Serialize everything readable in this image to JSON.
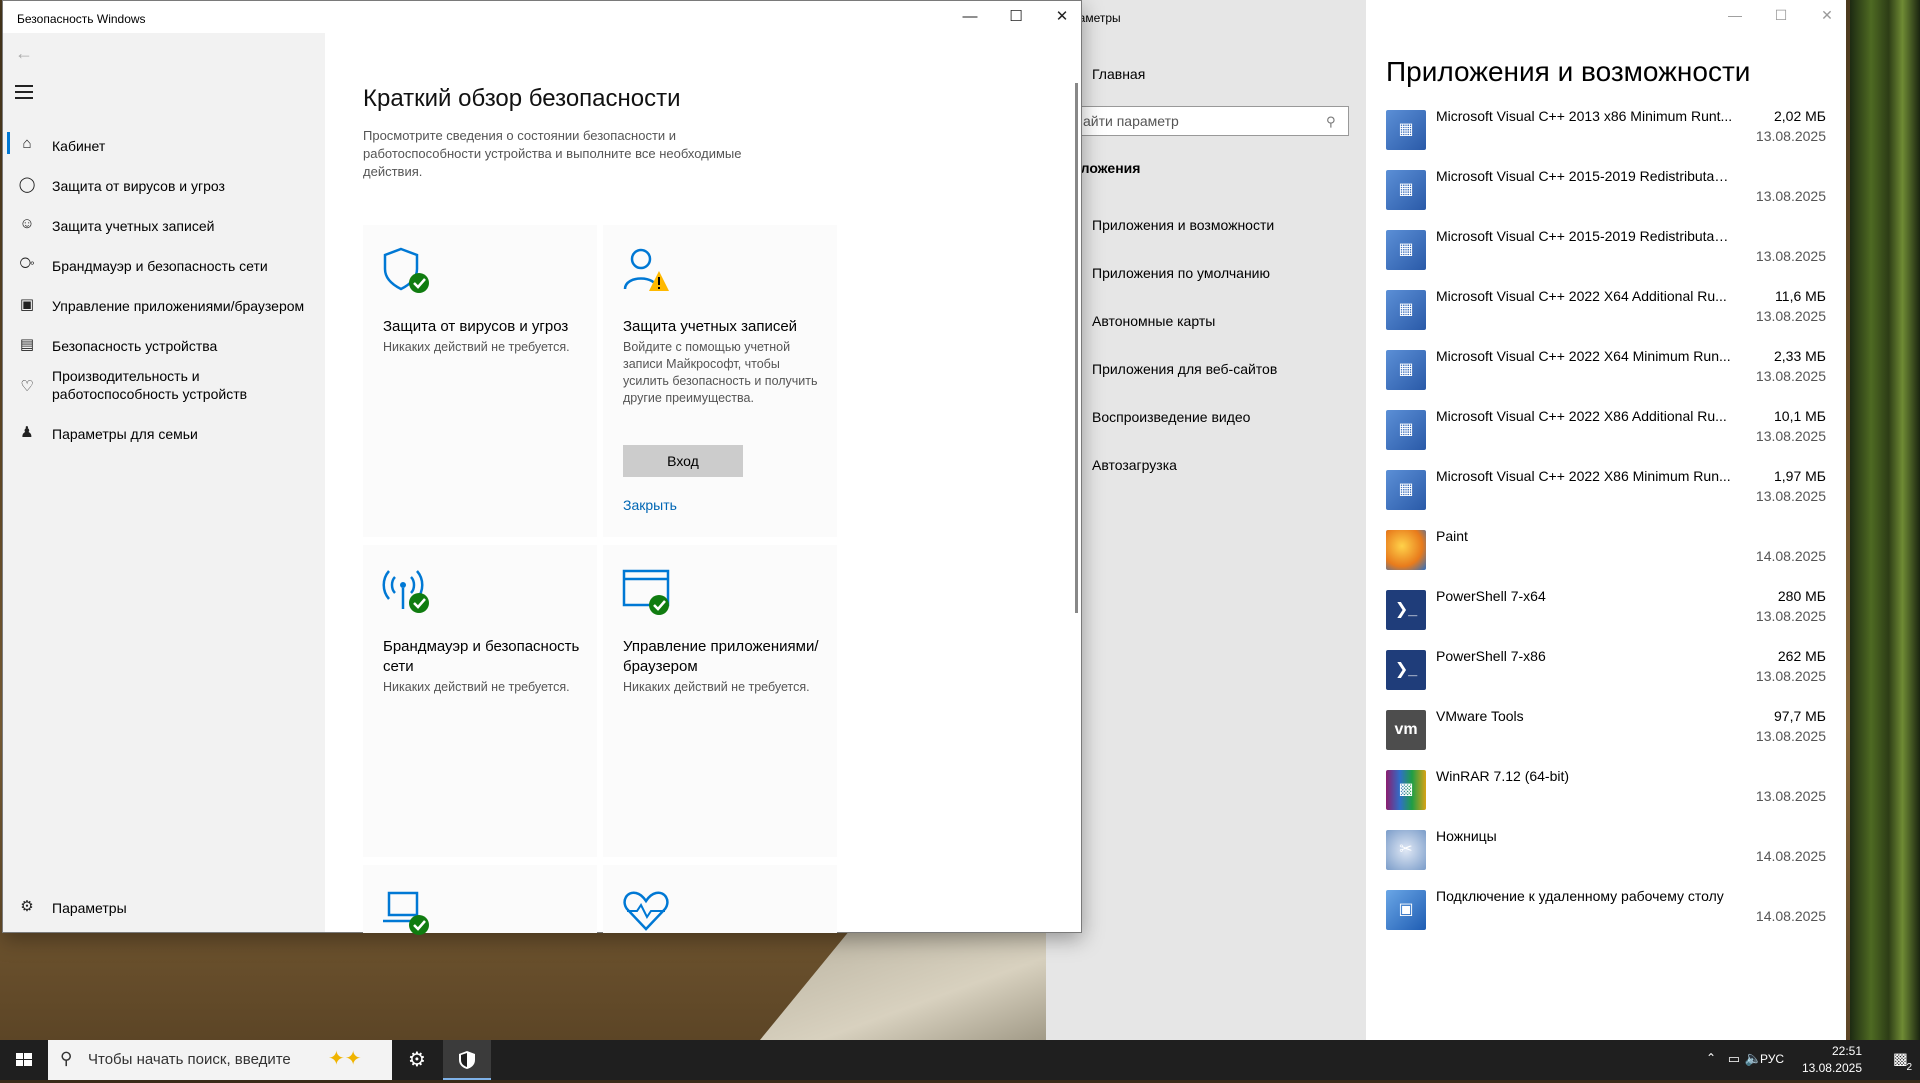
{
  "security_window": {
    "title": "Безопасность Windows",
    "nav": {
      "items": [
        {
          "label": "Кабинет",
          "icon": "home-icon"
        },
        {
          "label": "Защита от вирусов и угроз",
          "icon": "shield-icon"
        },
        {
          "label": "Защита учетных записей",
          "icon": "person-icon"
        },
        {
          "label": "Брандмауэр и безопасность сети",
          "icon": "wifi-signal-icon"
        },
        {
          "label": "Управление приложениями/браузером",
          "icon": "browser-icon"
        },
        {
          "label": "Безопасность устройства",
          "icon": "laptop-icon"
        },
        {
          "label": "Производительность и работоспособность устройств",
          "icon": "heart-icon"
        },
        {
          "label": "Параметры для семьи",
          "icon": "family-icon"
        }
      ],
      "settings_label": "Параметры"
    },
    "main": {
      "title": "Краткий обзор безопасности",
      "description": "Просмотрите сведения о состоянии безопасности и работоспособности устройства и выполните все необходимые действия.",
      "cards": [
        {
          "title": "Защита от вирусов и угроз",
          "subtitle": "Никаких действий не требуется.",
          "status": "ok"
        },
        {
          "title": "Защита учетных записей",
          "subtitle": "Войдите с помощью учетной записи Майкрософт, чтобы усилить безопасность и получить другие преимущества.",
          "status": "warning",
          "button": "Вход",
          "link": "Закрыть"
        },
        {
          "title": "Брандмауэр и безопасность сети",
          "subtitle": "Никаких действий не требуется.",
          "status": "ok"
        },
        {
          "title": "Управление приложениями/браузером",
          "subtitle": "Никаких действий не требуется.",
          "status": "ok"
        }
      ]
    }
  },
  "settings_window": {
    "title": "раметры",
    "home": "Главная",
    "search_placeholder": "айти параметр",
    "section": "иложения",
    "nav": [
      "Приложения и возможности",
      "Приложения по умолчанию",
      "Автономные карты",
      "Приложения для веб-сайтов",
      "Воспроизведение видео",
      "Автозагрузка"
    ],
    "apps_title": "Приложения и возможности",
    "apps": [
      {
        "name": "Microsoft Visual C++ 2013 x86 Minimum Runt...",
        "size": "2,02 МБ",
        "date": "13.08.2025",
        "icon": "installer-icon"
      },
      {
        "name": "Microsoft Visual C++ 2015-2019 Redistributabl...",
        "size": "",
        "date": "13.08.2025",
        "icon": "installer-icon"
      },
      {
        "name": "Microsoft Visual C++ 2015-2019 Redistributabl...",
        "size": "",
        "date": "13.08.2025",
        "icon": "installer-icon"
      },
      {
        "name": "Microsoft Visual C++ 2022 X64 Additional Ru...",
        "size": "11,6 МБ",
        "date": "13.08.2025",
        "icon": "installer-icon"
      },
      {
        "name": "Microsoft Visual C++ 2022 X64 Minimum Run...",
        "size": "2,33 МБ",
        "date": "13.08.2025",
        "icon": "installer-icon"
      },
      {
        "name": "Microsoft Visual C++ 2022 X86 Additional Ru...",
        "size": "10,1 МБ",
        "date": "13.08.2025",
        "icon": "installer-icon"
      },
      {
        "name": "Microsoft Visual C++ 2022 X86 Minimum Run...",
        "size": "1,97 МБ",
        "date": "13.08.2025",
        "icon": "installer-icon"
      },
      {
        "name": "Paint",
        "size": "",
        "date": "14.08.2025",
        "icon": "paint-icon"
      },
      {
        "name": "PowerShell 7-x64",
        "size": "280 МБ",
        "date": "13.08.2025",
        "icon": "powershell-icon"
      },
      {
        "name": "PowerShell 7-x86",
        "size": "262 МБ",
        "date": "13.08.2025",
        "icon": "powershell-icon"
      },
      {
        "name": "VMware Tools",
        "size": "97,7 МБ",
        "date": "13.08.2025",
        "icon": "vmware-icon"
      },
      {
        "name": "WinRAR 7.12 (64-bit)",
        "size": "",
        "date": "13.08.2025",
        "icon": "winrar-icon"
      },
      {
        "name": "Ножницы",
        "size": "",
        "date": "14.08.2025",
        "icon": "snipping-icon"
      },
      {
        "name": "Подключение к удаленному рабочему столу",
        "size": "",
        "date": "14.08.2025",
        "icon": "remote-desktop-icon"
      }
    ]
  },
  "taskbar": {
    "search_placeholder": "Чтобы начать поиск, введите",
    "language": "РУС",
    "time": "22:51",
    "date": "13.08.2025",
    "notification_count": "2"
  },
  "colors": {
    "accent": "#0078d4",
    "ok": "#107c10",
    "warning": "#ffb900",
    "link": "#0066b4"
  }
}
